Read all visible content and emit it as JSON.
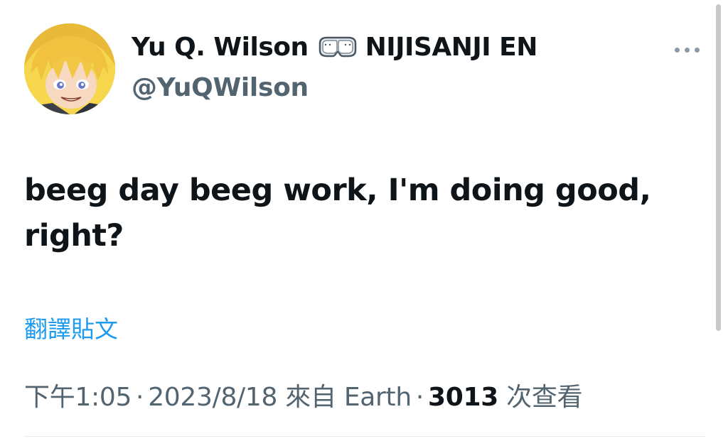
{
  "author": {
    "display_name": "Yu Q. Wilson",
    "org": "NIJISANJI EN",
    "handle": "@YuQWilson",
    "avatar_icon": "avatar-anime-character",
    "badge_icon": "goggles-icon"
  },
  "tweet": {
    "text_line1": "beeg day beeg work, I'm doing good,",
    "text_line2": "right?"
  },
  "actions": {
    "translate_label": "翻譯貼文",
    "more_icon": "more-horizontal-icon"
  },
  "meta": {
    "time": "下午1:05",
    "sep1": "·",
    "date": "2023/8/18",
    "source_prefix": "來自",
    "source": "Earth",
    "sep2": "·",
    "views": "3013",
    "views_suffix": "次查看"
  },
  "colors": {
    "text": "#0f1419",
    "secondary": "#536471",
    "link": "#1d9bf0"
  }
}
